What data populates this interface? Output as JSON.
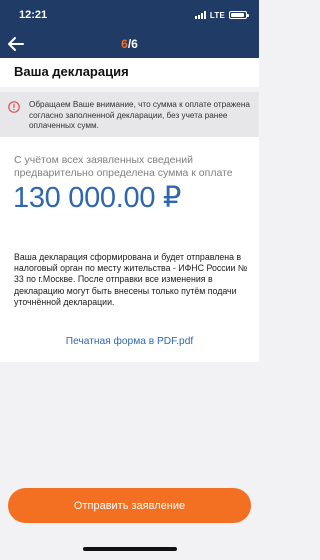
{
  "status_bar": {
    "time": "12:21",
    "network": "LTE"
  },
  "nav": {
    "step_current": "6",
    "step_total": "/6",
    "back_icon": "arrow-left-icon"
  },
  "page": {
    "title": "Ваша декларация"
  },
  "warning": {
    "icon": "exclamation-circle-icon",
    "text": "Обращаем Ваше внимание, что сумма к оплате отражена согласно заполненной декларации, без учета ранее оплаченных сумм."
  },
  "summary": {
    "caption": "С учётом всех заявленных сведений предварительно определена сумма к оплате",
    "amount": "130 000.00 ₽",
    "info": "Ваша декларация сформирована и будет отправлена в налоговый орган по месту жительства - ИФНС России № 33 по г.Москве. После отправки все изменения в декларацию могут быть внесены только путём подачи уточнённой декларации.",
    "pdf_link": "Печатная форма в PDF.pdf"
  },
  "actions": {
    "submit_label": "Отправить заявление"
  },
  "colors": {
    "header_bg": "#1f3b66",
    "accent": "#f36f21",
    "link": "#2f66b0",
    "warning_icon": "#d9534f"
  }
}
